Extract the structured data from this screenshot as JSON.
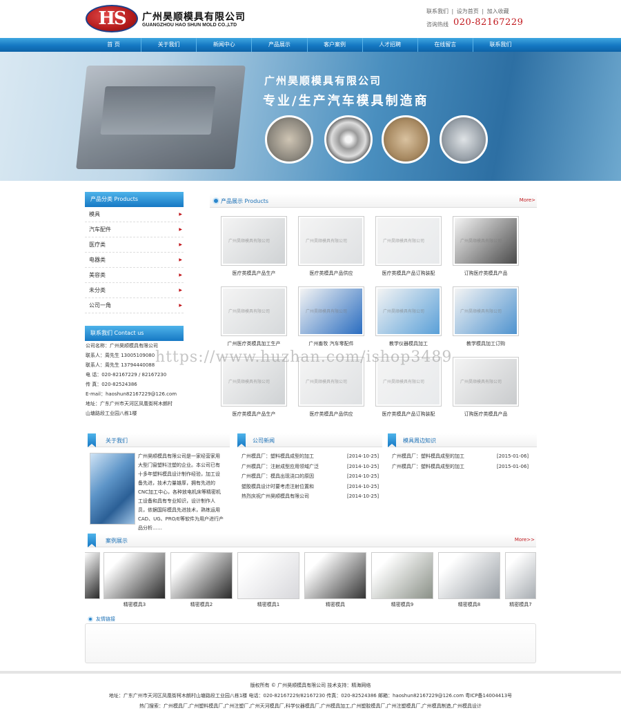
{
  "header": {
    "logo_text": "HS",
    "company_cn": "广州昊顺模具有限公司",
    "company_en": "GUANGZHOU HAO SHUN MOLD CO.,LTD",
    "top_links": [
      "联系我们",
      "|",
      "设为首页",
      "|",
      "加入收藏"
    ],
    "phone_label": "咨询热线",
    "phone": "020-82167229"
  },
  "nav": [
    "首 页",
    "关于我们",
    "新闻中心",
    "产品展示",
    "客户案例",
    "人才招聘",
    "在线留言",
    "联系我们"
  ],
  "banner": {
    "company": "广州昊顺模具有限公司",
    "slogan": "专业/生产汽车模具制造商"
  },
  "sidebar": {
    "categories_title": "产品分类 Products",
    "categories": [
      "模具",
      "汽车配件",
      "医疗类",
      "电器类",
      "美容类",
      "未分类",
      "公司一角"
    ],
    "contact_title": "联系我们 Contact us",
    "contact": [
      "公司名称：广州昊顺模具有限公司",
      "联系人：周先生 13005109080",
      "联系人：周先生 13794440088",
      "电 话：020-82167229 / 82167230",
      "传 真：020-82524386",
      "E-mail：haoshun82167229@126.com",
      "地址：广东广州市天河区凤凰街柯木朗村",
      "山塘路段工业园八栋1楼"
    ]
  },
  "products": {
    "title": "产品展示 Products",
    "more": "More>",
    "watermark": "广州昊顺模具有限公司",
    "items": [
      {
        "caption": "医疗类模具产品生产",
        "color": "#cfd2d4"
      },
      {
        "caption": "医疗类模具产品供应",
        "color": "#dfe1e3"
      },
      {
        "caption": "医疗类模具产品订购装配",
        "color": "#e8eaec"
      },
      {
        "caption": "订购医疗类模具产品",
        "color": "#4a4a4a"
      },
      {
        "caption": "广州医疗类模具加工生产",
        "color": "#d6d9db"
      },
      {
        "caption": "广州畜牧 汽车零配件",
        "color": "#2a6dc0"
      },
      {
        "caption": "教学仪器模具加工",
        "color": "#5aa0d8"
      },
      {
        "caption": "教学模具加工订购",
        "color": "#4f93cf"
      },
      {
        "caption": "医疗类模具产品生产",
        "color": "#cfd2d4"
      },
      {
        "caption": "医疗类模具产品供应",
        "color": "#dfe1e3"
      },
      {
        "caption": "医疗类模具产品订购装配",
        "color": "#e8eaec"
      },
      {
        "caption": "订购医疗类模具产品",
        "color": "#c9cbcd"
      }
    ]
  },
  "about": {
    "title": "关于我们",
    "text": "广州昊顺模具有限公司是一家经营家用大型门窗塑料注塑的企业。本公司已有十多年塑料模具设计制作经验，加工设备先进，技术力量雄厚，拥有先进的CNC加工中心，各种放电机床等精密机工设备和具有专业知识，设计制作人员，依据国际模具先进技术，熟练运用CAD、UG、PRO/E等软件为用户进行产品分析……"
  },
  "news": {
    "title": "公司新闻",
    "items": [
      {
        "text": "广州模具厂：塑料模具成型的加工",
        "date": "[2014-10-25]"
      },
      {
        "text": "广州模具厂：注射成型应用领域广泛",
        "date": "[2014-10-25]"
      },
      {
        "text": "广州模具厂：模具出现浇口的原因",
        "date": "[2014-10-25]"
      },
      {
        "text": "塑胶模具设计时要考虑注射位置和",
        "date": "[2014-10-25]"
      },
      {
        "text": "热烈庆祝广州昊顺模具有限公司",
        "date": "[2014-10-25]"
      }
    ]
  },
  "knowledge": {
    "title": "模具周边知识",
    "items": [
      {
        "text": "广州模具厂：塑料模具成型的加工",
        "date": "[2015-01-06]"
      },
      {
        "text": "广州模具厂：塑料模具成型的加工",
        "date": "[2015-01-06]"
      }
    ]
  },
  "cases": {
    "title": "案例展示",
    "more": "More>>",
    "items": [
      {
        "caption": "精密模具3",
        "color": "#2a2a2a"
      },
      {
        "caption": "精密模具2",
        "color": "#2a2a2a"
      },
      {
        "caption": "精密模具1",
        "color": "#d8d8dc"
      },
      {
        "caption": "精密模具",
        "color": "#333333"
      },
      {
        "caption": "精密模具9",
        "color": "#8a9087"
      },
      {
        "caption": "精密模具8",
        "color": "#9aa0a6"
      },
      {
        "caption": "精密模具7",
        "color": "#a8adb2"
      }
    ]
  },
  "links_title": "友情链接",
  "watermark": "https://www.huzhan.com/ishop3489",
  "footer": {
    "line1": "版权所有 © 广州昊顺模具有限公司  技术支持：精海网络",
    "line2": "地址：广东广州市天河区凤凰街柯木朗村山塘路段工业园八栋1楼  电话：020-82167229/82167230  传真：020-82524386  邮箱：haoshun82167229@126.com  粤ICP备14004413号",
    "line3": "热门搜索：广州模具厂,广州塑料模具厂,广州注塑厂,广州天河模具厂,科学仪器模具厂,广州模具加工,广州塑胶模具厂,广州注塑模具厂,广州模具制造,广州模具设计"
  }
}
